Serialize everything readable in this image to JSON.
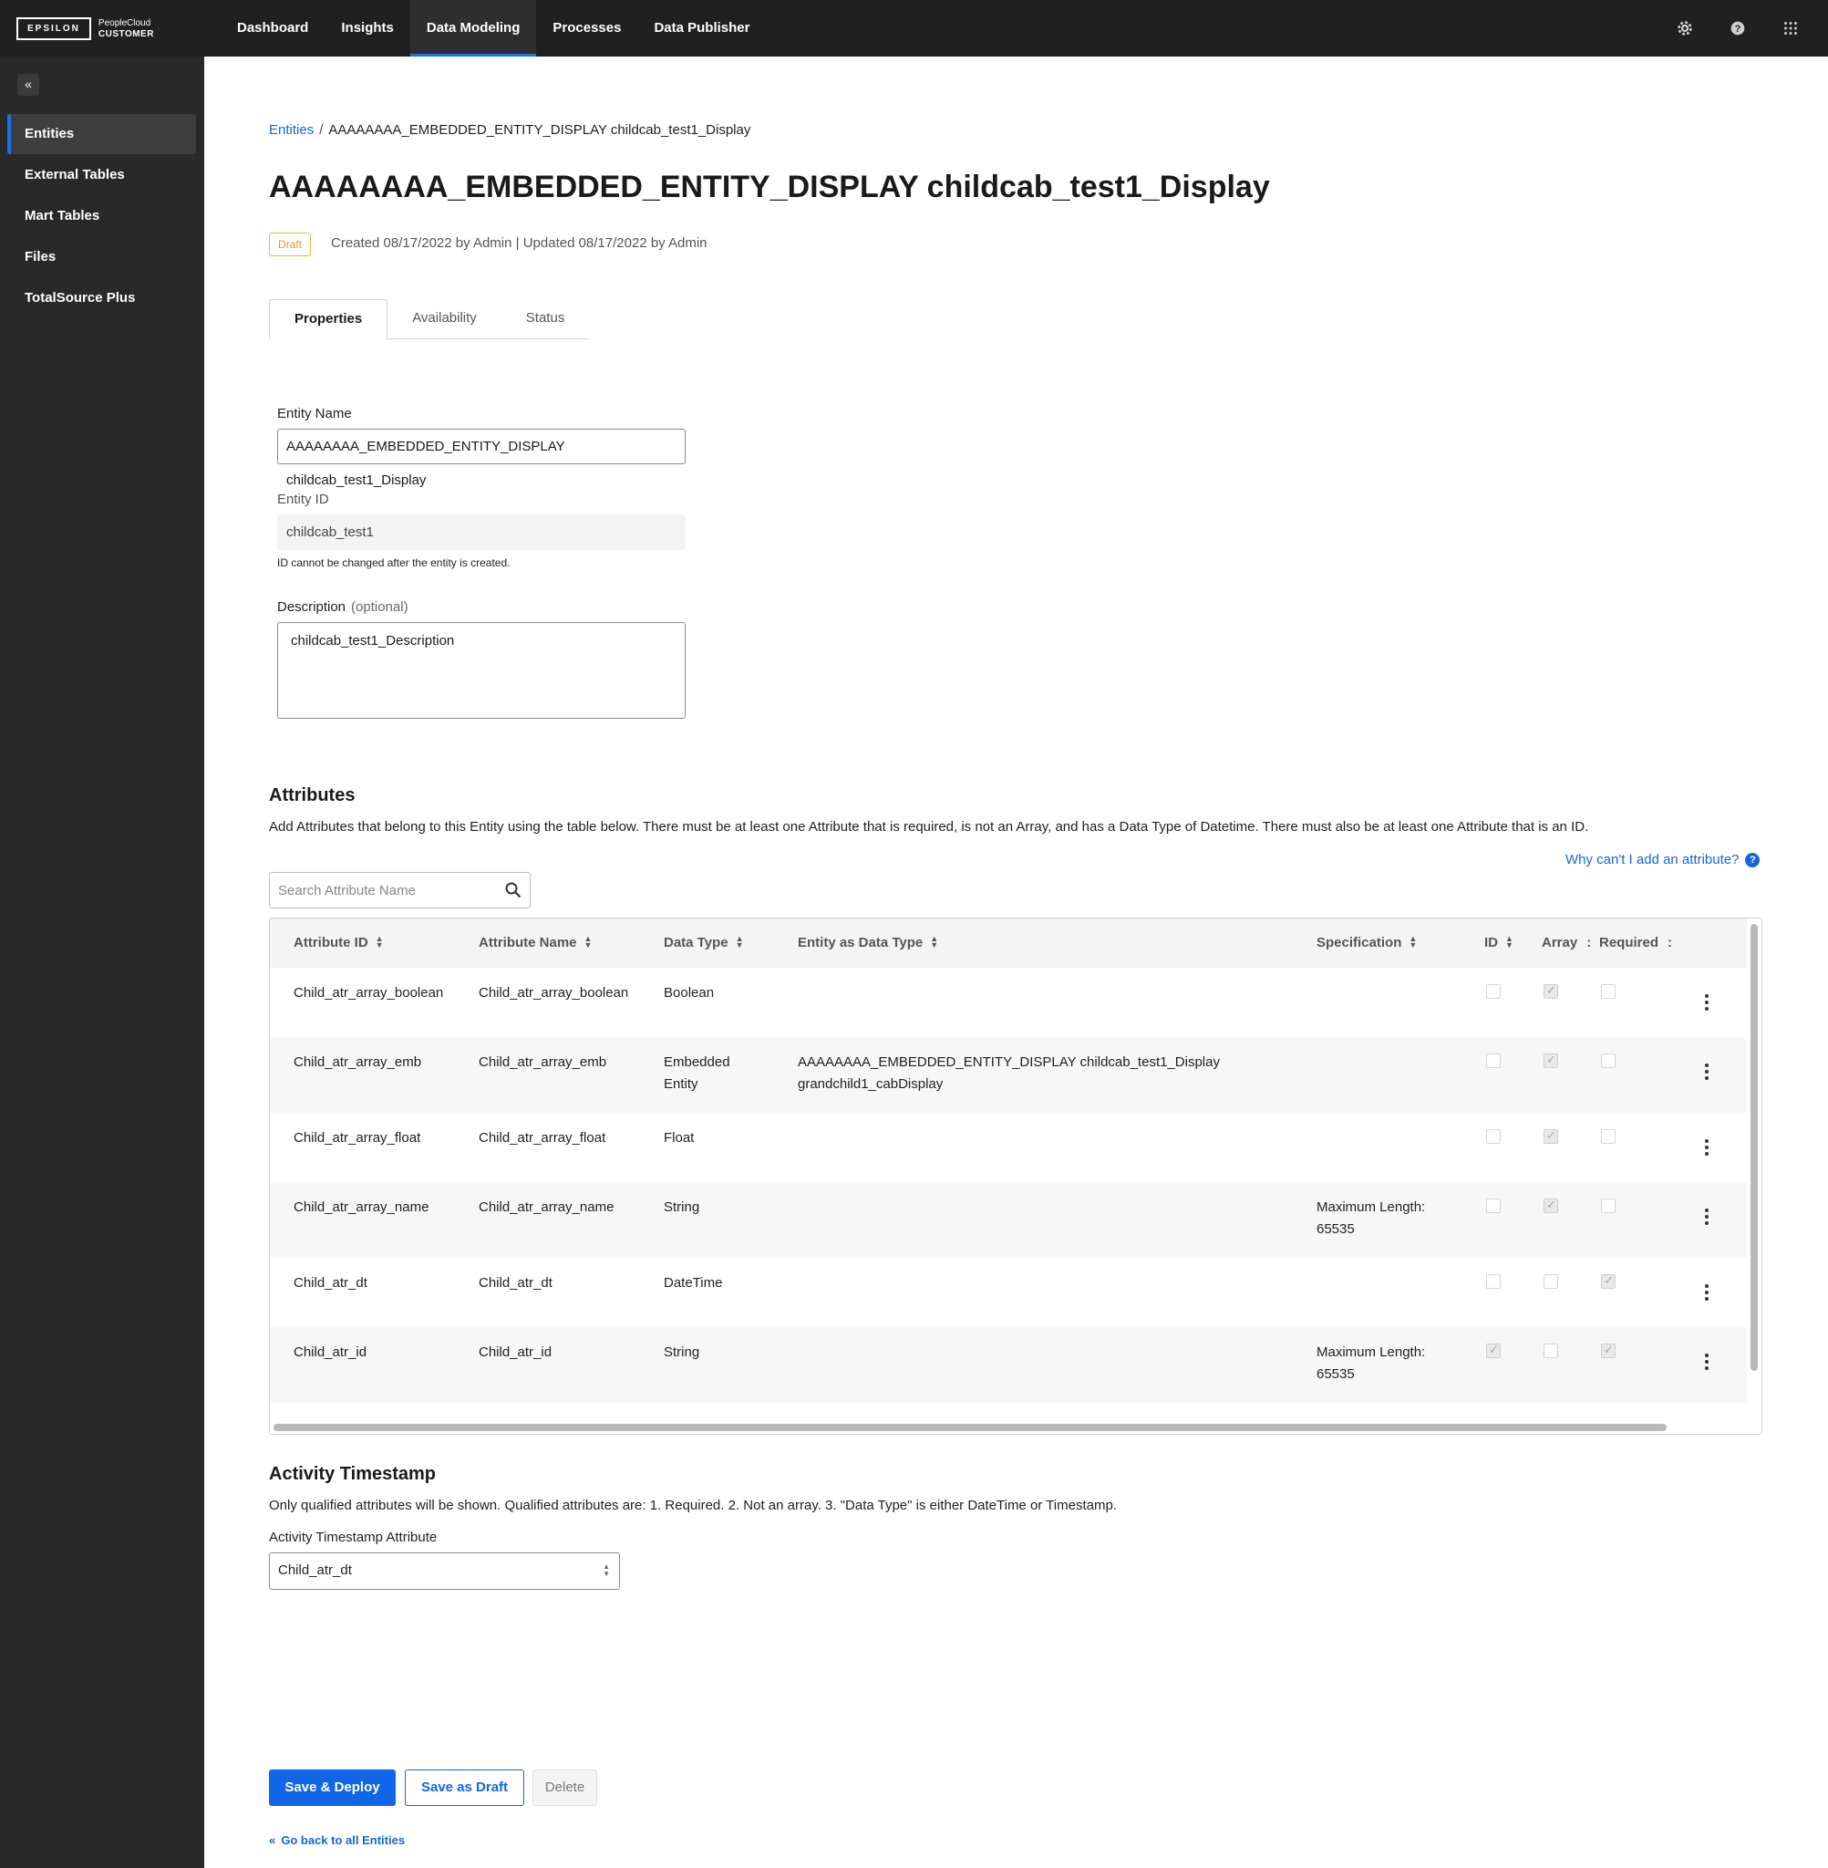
{
  "brand": {
    "logo": "EPSILON",
    "product_line1": "PeopleCloud",
    "product_line2": "CUSTOMER"
  },
  "topnav": {
    "items": [
      "Dashboard",
      "Insights",
      "Data Modeling",
      "Processes",
      "Data Publisher"
    ],
    "active": "Data Modeling",
    "icons": [
      "gear-icon",
      "help-icon",
      "apps-grid-icon"
    ]
  },
  "sidebar": {
    "collapse_icon": "double-chevron-left-icon",
    "items": [
      "Entities",
      "External Tables",
      "Mart Tables",
      "Files",
      "TotalSource Plus"
    ],
    "active": "Entities"
  },
  "breadcrumb": {
    "root": "Entities",
    "separator": "/",
    "current": "AAAAAAAA_EMBEDDED_ENTITY_DISPLAY childcab_test1_Display"
  },
  "page": {
    "title": "AAAAAAAA_EMBEDDED_ENTITY_DISPLAY childcab_test1_Display",
    "status_badge": "Draft",
    "meta": "Created 08/17/2022 by Admin | Updated 08/17/2022 by Admin"
  },
  "tabs": [
    "Properties",
    "Availability",
    "Status"
  ],
  "form": {
    "entity_name_label": "Entity Name",
    "entity_name_value": "AAAAAAAA_EMBEDDED_ENTITY_DISPLAY childcab_test1_Display",
    "entity_id_label": "Entity ID",
    "entity_id_value": "childcab_test1",
    "entity_id_help": "ID cannot be changed after the entity is created.",
    "description_label": "Description",
    "description_optional": "(optional)",
    "description_value": "childcab_test1_Description"
  },
  "attributes": {
    "heading": "Attributes",
    "instructions": "Add Attributes that belong to this Entity using the table below. There must be at least one Attribute that is required, is not an Array, and has a Data Type of Datetime. There must also be at least one Attribute that is an ID.",
    "why_link": "Why can't I add an attribute?",
    "search_placeholder": "Search Attribute Name",
    "columns": [
      "Attribute ID",
      "Attribute Name",
      "Data Type",
      "Entity as Data Type",
      "Specification",
      "ID",
      "Array",
      "Required"
    ],
    "column_menu_glyph": ":",
    "rows": [
      {
        "attr_id": "Child_atr_array_boolean",
        "attr_name": "Child_atr_array_boolean",
        "type1": "Boolean",
        "type2": "",
        "entity1": "",
        "entity2": "",
        "spec1": "",
        "spec2": "",
        "id": false,
        "array": true,
        "required": false
      },
      {
        "attr_id": "Child_atr_array_emb",
        "attr_name": "Child_atr_array_emb",
        "type1": "Embedded",
        "type2": "Entity",
        "entity1": "AAAAAAAA_EMBEDDED_ENTITY_DISPLAY childcab_test1_Display",
        "entity2": "grandchild1_cabDisplay",
        "spec1": "",
        "spec2": "",
        "id": false,
        "array": true,
        "required": false
      },
      {
        "attr_id": "Child_atr_array_float",
        "attr_name": "Child_atr_array_float",
        "type1": "Float",
        "type2": "",
        "entity1": "",
        "entity2": "",
        "spec1": "",
        "spec2": "",
        "id": false,
        "array": true,
        "required": false
      },
      {
        "attr_id": "Child_atr_array_name",
        "attr_name": "Child_atr_array_name",
        "type1": "String",
        "type2": "",
        "entity1": "",
        "entity2": "",
        "spec1": "Maximum Length:",
        "spec2": "65535",
        "id": false,
        "array": true,
        "required": false
      },
      {
        "attr_id": "Child_atr_dt",
        "attr_name": "Child_atr_dt",
        "type1": "DateTime",
        "type2": "",
        "entity1": "",
        "entity2": "",
        "spec1": "",
        "spec2": "",
        "id": false,
        "array": false,
        "required": true
      },
      {
        "attr_id": "Child_atr_id",
        "attr_name": "Child_atr_id",
        "type1": "String",
        "type2": "",
        "entity1": "",
        "entity2": "",
        "spec1": "Maximum Length:",
        "spec2": "65535",
        "id": true,
        "array": false,
        "required": true
      }
    ]
  },
  "activity": {
    "heading": "Activity Timestamp",
    "note": "Only qualified attributes will be shown. Qualified attributes are: 1. Required. 2. Not an array. 3. \"Data Type\" is either DateTime or Timestamp.",
    "field_label": "Activity Timestamp Attribute",
    "selected": "Child_atr_dt"
  },
  "actions": {
    "save_deploy": "Save & Deploy",
    "save_draft": "Save as Draft",
    "delete": "Delete",
    "back_link": "Go back to all Entities"
  },
  "colors": {
    "accent": "#1166e8",
    "topbar": "#202020",
    "sidebar": "#292929",
    "draft_badge": "#e9b43a"
  }
}
